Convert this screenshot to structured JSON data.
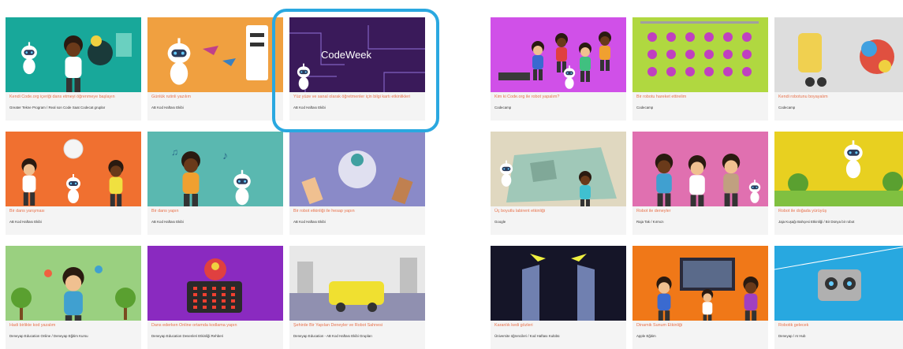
{
  "left_cards": [
    {
      "title": "Kendi Code.org içeriği dans etmeyi öğrenmeye başlayın",
      "author": "Greater Tekne Program / Real son Code Saat Codecat gruplar",
      "bg": "#18a89a"
    },
    {
      "title": "Günlük rutinli yazılım",
      "author": "AB Kod Haftası Ekibi",
      "bg": "#f0a040"
    },
    {
      "title": "Yüz yüze ve sanal olarak öğretmenler için bilgi kartı etkinlikleri",
      "author": "AB Kod Haftası Ekibi",
      "bg": "#3a1a5a",
      "brand": "CodeWeek"
    },
    {
      "title": "Bir dans yarışması",
      "author": "AB Kod Haftası Ekibi",
      "bg": "#f07030"
    },
    {
      "title": "Bir dans yapın",
      "author": "AB Kod Haftası Ekibi",
      "bg": "#5ab8b0"
    },
    {
      "title": "Bir robot etkinliği ile hesap yapın",
      "author": "AB Kod Haftası Ekibi",
      "bg": "#8a8ac8"
    },
    {
      "title": "Hadi birlikte kod yazalım",
      "author": "Deneyap Education Online / Deneyap Eğitim Kursu",
      "bg": "#9ad080"
    },
    {
      "title": "Dans ederken Online ortamda kodlama yapın",
      "author": "Deneyap Education Desenleri Etkinliği Rehberi",
      "bg": "#8a2ac0"
    },
    {
      "title": "Şehirde Bir Yapılan Deneyler ve Robot Sahnesi",
      "author": "Deneyap Education - AB Kod Haftası Ekibi Grupları",
      "bg": "#e8e8e8"
    }
  ],
  "right_cards": [
    {
      "title": "Kim ki Code.org ile robot yapalım?",
      "author": "Codecamp",
      "bg": "#d050e8"
    },
    {
      "title": "Bir robotu hareket ettirelim",
      "author": "Codecamp",
      "bg": "#b0d840"
    },
    {
      "title": "Kendi robotunu boyayalım",
      "author": "Codecamp",
      "bg": "#dddddd"
    },
    {
      "title": "Üç boyutlu labirent etkinliği",
      "author": "Google",
      "bg": "#e0d8c0"
    },
    {
      "title": "Robot ile deneyler",
      "author": "Raja Tak / Kırmızı",
      "bg": "#e070b0"
    },
    {
      "title": "Robot ile doğada yürüyüş",
      "author": "Jaja Kuşağı Bahçesi Etkinliği / Bir Dünya bir robot",
      "bg": "#e8d020"
    },
    {
      "title": "Karanlık kedi gözleri",
      "author": "Üniversite öğrencileri / Kod Haftası Kulübü",
      "bg": "#151528"
    },
    {
      "title": "Dinamik Sunum Etkinliği",
      "author": "Apple Eğitim",
      "bg": "#f07818"
    },
    {
      "title": "Robotik gelecek",
      "author": "Deneyap / AI Hub",
      "bg": "#28a8e0"
    }
  ]
}
